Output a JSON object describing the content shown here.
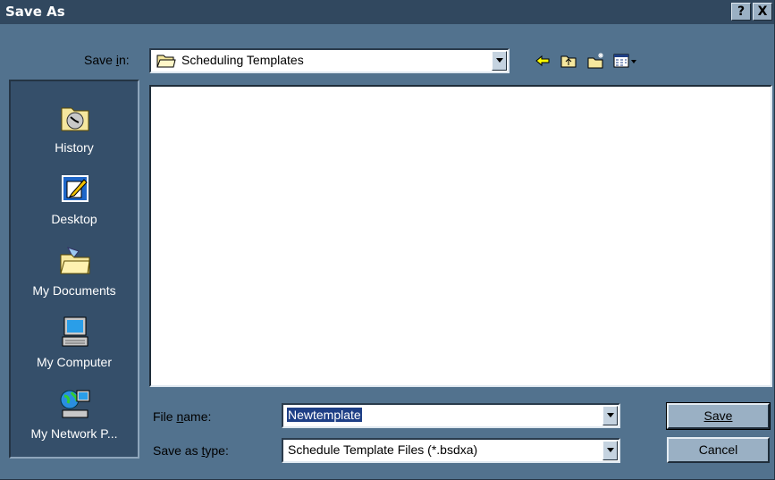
{
  "dialog": {
    "title": "Save As",
    "help_btn": "?",
    "close_btn": "X"
  },
  "save_in": {
    "label": "Save in:",
    "value": "Scheduling Templates"
  },
  "places": [
    {
      "label": "History"
    },
    {
      "label": "Desktop"
    },
    {
      "label": "My Documents"
    },
    {
      "label": "My Computer"
    },
    {
      "label": "My Network P..."
    }
  ],
  "file_name": {
    "label": "File name:",
    "value": "Newtemplate"
  },
  "save_as_type": {
    "label": "Save as type:",
    "value": "Schedule Template Files (*.bsdxa)"
  },
  "buttons": {
    "save": "Save",
    "cancel": "Cancel"
  },
  "icons": {
    "back": "back-arrow-icon",
    "up": "up-folder-icon",
    "new_folder": "new-folder-icon",
    "views": "views-menu-icon"
  }
}
